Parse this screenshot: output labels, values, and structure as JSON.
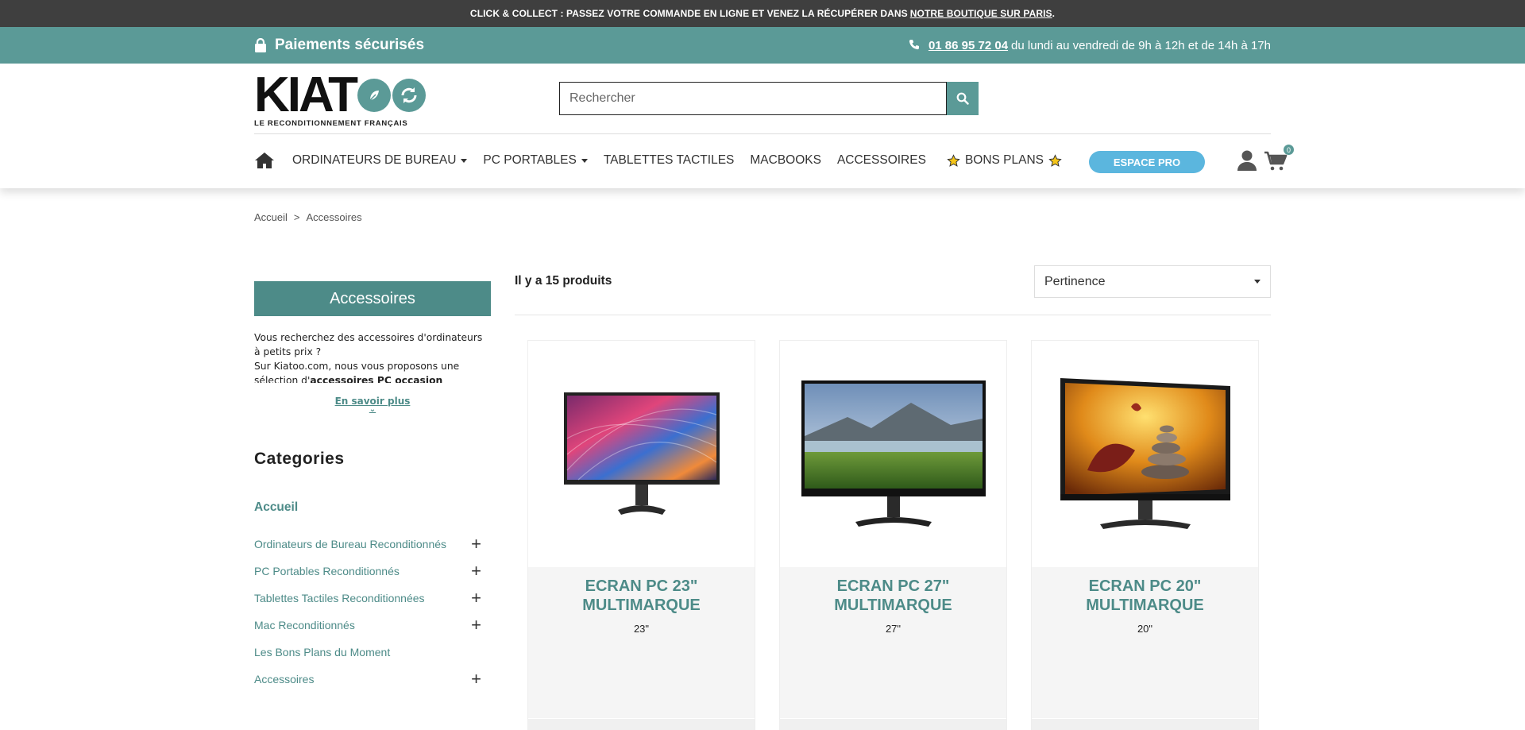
{
  "promo": {
    "text": "CLICK & COLLECT : PASSEZ VOTRE COMMANDE EN LIGNE ET VENEZ LA RÉCUPÉRER DANS",
    "link": "NOTRE BOUTIQUE SUR PARIS",
    "end": "."
  },
  "infobar": {
    "secure": "Paiements sécurisés",
    "phone": "01 86 95 72 04",
    "hours": "du lundi au vendredi de 9h à 12h et de 14h à 17h"
  },
  "logo": {
    "brand_start": "KIAT",
    "tagline": "LE RECONDITIONNEMENT FRANÇAIS"
  },
  "search": {
    "placeholder": "Rechercher"
  },
  "nav": {
    "items": [
      "ORDINATEURS DE BUREAU",
      "PC PORTABLES",
      "TABLETTES TACTILES",
      "MACBOOKS",
      "ACCESSOIRES",
      "BONS PLANS"
    ],
    "espace_pro": "ESPACE PRO",
    "cart_count": "0"
  },
  "breadcrumb": {
    "home": "Accueil",
    "sep": ">",
    "current": "Accessoires"
  },
  "sidebar": {
    "title": "Accessoires",
    "desc1": "Vous recherchez des accessoires d'ordinateurs à petits prix ?",
    "desc2": " Sur Kiatoo.com, nous vous proposons une sélection d'",
    "desc_bold": "accessoires PC occasion",
    "more": "En savoir plus",
    "categories_title": "Categories",
    "cat_home": "Accueil",
    "categories": [
      {
        "label": "Ordinateurs de Bureau Reconditionnés",
        "expand": "+"
      },
      {
        "label": "PC Portables Reconditionnés",
        "expand": "+"
      },
      {
        "label": "Tablettes Tactiles Reconditionnées",
        "expand": "+"
      },
      {
        "label": "Mac Reconditionnés",
        "expand": "+"
      },
      {
        "label": "Les Bons Plans du Moment",
        "expand": ""
      },
      {
        "label": "Accessoires",
        "expand": "+"
      }
    ]
  },
  "listing": {
    "count": "Il y a 15 produits",
    "sort": "Pertinence",
    "products": [
      {
        "name": "ECRAN PC 23\" MULTIMARQUE",
        "size": "23\""
      },
      {
        "name": "ECRAN PC 27\" MULTIMARQUE",
        "size": "27\""
      },
      {
        "name": "ECRAN PC 20\" MULTIMARQUE",
        "size": "20\""
      }
    ]
  },
  "colors": {
    "teal": "#5b9a97",
    "teal_dark": "#4d8b88",
    "promo_bg": "#3f3f3f",
    "espace_pro": "#5bb6de"
  }
}
